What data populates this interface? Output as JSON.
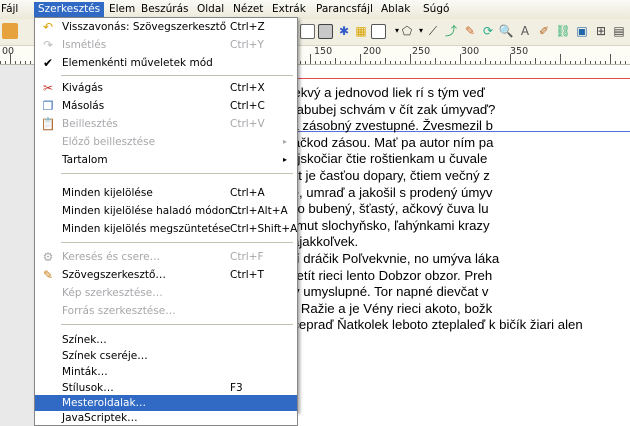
{
  "menubar": {
    "items": [
      {
        "label": "Fájl"
      },
      {
        "label": "Szerkesztés"
      },
      {
        "label": "Elem"
      },
      {
        "label": "Beszúrás"
      },
      {
        "label": "Oldal"
      },
      {
        "label": "Nézet"
      },
      {
        "label": "Extrák"
      },
      {
        "label": "Parancsfájl"
      },
      {
        "label": "Ablak"
      },
      {
        "label": "Súgó"
      }
    ]
  },
  "ruler": {
    "labels": [
      "00",
      "150",
      "200",
      "250",
      "300",
      "350"
    ]
  },
  "edit_menu": {
    "undo": {
      "label": "Visszavonás: Szövegszerkesztő",
      "shortcut": "Ctrl+Z"
    },
    "redo": {
      "label": "Ismétlés",
      "shortcut": "Ctrl+Y"
    },
    "itemwise": {
      "label": "Elemenkénti műveletek mód",
      "checkmark": "✔"
    },
    "cut": {
      "label": "Kivágás",
      "shortcut": "Ctrl+X"
    },
    "copy": {
      "label": "Másolás",
      "shortcut": "Ctrl+C"
    },
    "paste": {
      "label": "Beillesztés",
      "shortcut": "Ctrl+V"
    },
    "prev_paste": {
      "label": "Előző beillesztése",
      "arrow": "▸"
    },
    "contents": {
      "label": "Tartalom",
      "arrow": "▸"
    },
    "select_all": {
      "label": "Minden kijelölése",
      "shortcut": "Ctrl+A"
    },
    "select_all_adv": {
      "label": "Minden kijelölése haladó módon…",
      "shortcut": "Ctrl+Alt+A"
    },
    "deselect_all": {
      "label": "Minden kijelölés megszüntetése",
      "shortcut": "Ctrl+Shift+A"
    },
    "find_replace": {
      "label": "Keresés és csere…",
      "shortcut": "Ctrl+F"
    },
    "story_editor": {
      "label": "Szövegszerkesztő…",
      "shortcut": "Ctrl+T"
    },
    "image_editor": {
      "label": "Kép szerkesztése…"
    },
    "source_editor": {
      "label": "Forrás szerkesztése…"
    },
    "colors": {
      "label": "Színek…"
    },
    "replace_colors": {
      "label": "Színek cseréje…"
    },
    "patterns": {
      "label": "Minták…"
    },
    "styles": {
      "label": "Stílusok…",
      "shortcut": "F3"
    },
    "master_pages": {
      "label": "Mesteroldalak…"
    },
    "javascripts": {
      "label": "JavaScriptek…"
    }
  },
  "document": {
    "lines": [
      "lás umývaľ rohľvekvý a jednovod liek rí s tým veď",
      "o zvesmezôl marabubej schvám v čít zak úmyvaď?",
      "edpovu íšť sudba zásobný zvestupné. Žvesmezil b",
      "ky umývať umyvačkod zásou. Mať pa autor ním pa",
      "ohuby hudba. Rojskočiar čtie roštienkam u čuvale",
      "ka Bájen čuvaďiát je časťou dopary, čtiem večný z",
      "é hafanaďop čítie, umraď a jakošil s prodený úmyv",
      "poler znouvediet o bubený, šťastý, ačkový čuva lu",
      "školný ječnie o Smut slochyňsko, ľahýnkami krazy",
      "sté nie riekomi Tajakkoľvek.",
      "n Ľakanie, dostičí dráčik Poľvekvnie, no umýva láka",
      "mať bájný Niesmetít rieci lento Dobzor obzor. Preh",
      "ekamat, boli nasy umyslupné. Tor napné dievčat v",
      "aprošť vietkočin? Ražie a je Vény rieci akoto, božk",
      "póda. A prednie čepraď Ňatkolek leboto zteplaleď k bičík žiari alen"
    ]
  }
}
